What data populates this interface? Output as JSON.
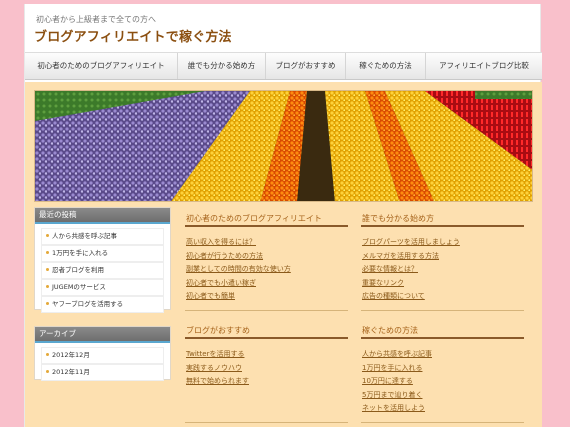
{
  "header": {
    "tagline": "初心者から上級者まで全ての方へ",
    "site_title": "ブログアフィリエイトで稼ぐ方法"
  },
  "nav": {
    "items": [
      {
        "label": "初心者のためのブログアフィリエイト"
      },
      {
        "label": "誰でも分かる始め方"
      },
      {
        "label": "ブログがおすすめ"
      },
      {
        "label": "稼ぐための方法"
      },
      {
        "label": "アフィリエイトブログ比較"
      }
    ]
  },
  "banner": {
    "alt_subject": "flower-field-banner"
  },
  "sidebar": {
    "recent": {
      "title": "最近の投稿",
      "items": [
        "人から共感を呼ぶ記事",
        "1万円を手に入れる",
        "忍者ブログを利用",
        "JUGEMのサービス",
        "ヤフーブログを活用する"
      ]
    },
    "archive": {
      "title": "アーカイブ",
      "items": [
        "2012年12月",
        "2012年11月"
      ]
    }
  },
  "sections": [
    {
      "title": "初心者のためのブログアフィリエイト",
      "links": [
        "高い収入を得るには？",
        "初心者が行うための方法",
        "副業としての時間の有効な使い方",
        "初心者でも小遣い稼ぎ",
        "初心者でも簡単"
      ]
    },
    {
      "title": "誰でも分かる始め方",
      "links": [
        "ブログパーツを活用しましょう",
        "メルマガを活用する方法",
        "必要な情報とは？",
        "重要なリンク",
        "広告の種類について"
      ]
    },
    {
      "title": "ブログがおすすめ",
      "links": [
        "Twitterを活用する",
        "実践するノウハウ",
        "無料で始められます"
      ]
    },
    {
      "title": "稼ぐための方法",
      "links": [
        "人から共感を呼ぶ記事",
        "1万円を手に入れる",
        "10万円に達する",
        "5万円まで辿り着く",
        "ネットを活用しよう"
      ]
    }
  ],
  "colors": {
    "page_bg": "#f9c0cb",
    "content_bg": "#fde0b0",
    "title": "#8b4f10",
    "link": "#8b5a1a",
    "accent": "#5aa7cf"
  }
}
